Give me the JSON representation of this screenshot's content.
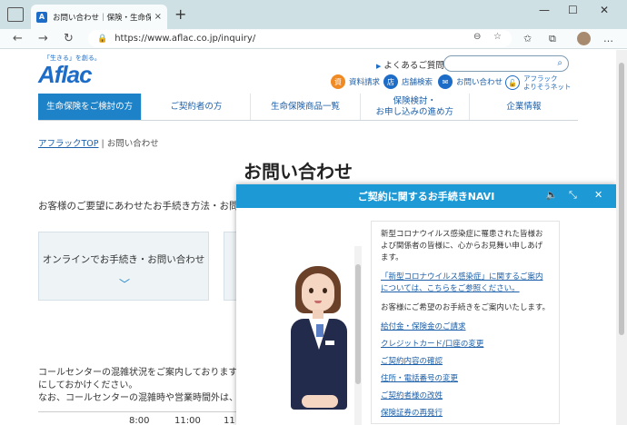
{
  "browser": {
    "tab_title": "お問い合わせ｜保険・生命保険はアフラック",
    "favicon_letter": "A",
    "url": "https://www.aflac.co.jp/inquiry/",
    "new_tab": "+",
    "tab_close": "×",
    "minimize": "—",
    "maximize": "☐",
    "close": "✕",
    "back": "←",
    "forward": "→",
    "reload": "↻",
    "lock": "🔒",
    "zoom": "⊖",
    "favorite": "☆",
    "favorites_bar": "✩",
    "collections": "⧉",
    "more": "…"
  },
  "header": {
    "logo_tagline": "「生きる」を創る。",
    "logo": "Aflac",
    "faq_arrow": "▶",
    "faq": "よくあるご質問",
    "search_icon": "⌕",
    "utilities": [
      {
        "icon": "資",
        "label": "資料請求",
        "color": "#f08a24"
      },
      {
        "icon": "店",
        "label": "店舗検索",
        "color": "#1d6cc7"
      },
      {
        "icon": "✉",
        "label": "お問い合わせ",
        "color": "#1d6cc7"
      },
      {
        "icon": "🔓",
        "label_line1": "アフラック",
        "label_line2": "よりそうネット"
      }
    ]
  },
  "nav": {
    "items": [
      {
        "label": "生命保険をご検討の方"
      },
      {
        "label": "ご契約者の方"
      },
      {
        "label": "生命保険商品一覧"
      },
      {
        "label_line1": "保険検討・",
        "label_line2": "お申し込みの進め方"
      },
      {
        "label": "企業情報"
      }
    ]
  },
  "main": {
    "breadcrumb_home": "アフラックTOP",
    "breadcrumb_sep": "|",
    "breadcrumb_current": "お問い合わせ",
    "title": "お問い合わせ",
    "intro": "お客様のご要望にあわせたお手続き方法・お問",
    "card1_label": "オンラインでお手続き・お問い合わせ",
    "card1_chevron": "﹀",
    "line1": "コールセンターの混雑状況をご案内しております。ご",
    "line2": "にしておかけください。",
    "line3": "なお、コールセンターの混雑時や営業時間外は、オ",
    "table_cells": [
      "8:00",
      "11:00",
      "11"
    ]
  },
  "navi": {
    "title": "ご契約に関するお手続きNAVI",
    "sound_icon": "🔈",
    "shrink_icon": "⤡",
    "close_icon": "✕",
    "notice": "新型コロナウイルス感染症に罹患された皆様および関係者の皆様に、心からお見舞い申しあげます。",
    "covid_link": "「新型コロナウイルス感染症」に関するご案内については、こちらをご参照ください。",
    "prompt": "お客様にご希望のお手続きをご案内いたします。",
    "options": [
      "給付金・保険金のご請求",
      "クレジットカード/口座の変更",
      "ご契約内容の確認",
      "住所・電話番号の変更",
      "ご契約者様の改姓",
      "保険証券の再発行"
    ]
  }
}
